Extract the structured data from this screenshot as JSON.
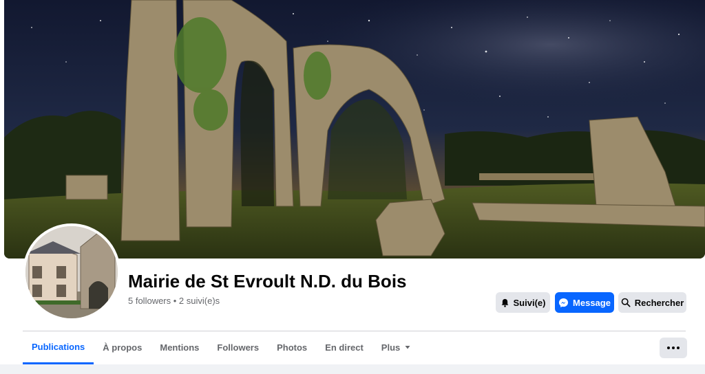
{
  "page": {
    "title": "Mairie de St Evroult N.D. du Bois",
    "stats": "5 followers • 2 suivi(e)s"
  },
  "actions": {
    "follow_label": "Suivi(e)",
    "message_label": "Message",
    "search_label": "Rechercher"
  },
  "tabs": [
    {
      "label": "Publications",
      "active": true
    },
    {
      "label": "À propos"
    },
    {
      "label": "Mentions"
    },
    {
      "label": "Followers"
    },
    {
      "label": "Photos"
    },
    {
      "label": "En direct"
    },
    {
      "label": "Plus"
    }
  ],
  "icons": {
    "follow": "bell-icon",
    "message": "messenger-icon",
    "search": "search-icon",
    "more_tab": "caret-down-icon",
    "more_button": "more-horizontal-icon"
  },
  "colors": {
    "accent": "#0866ff",
    "button_gray": "#e4e6eb",
    "text_secondary": "#65676b"
  }
}
